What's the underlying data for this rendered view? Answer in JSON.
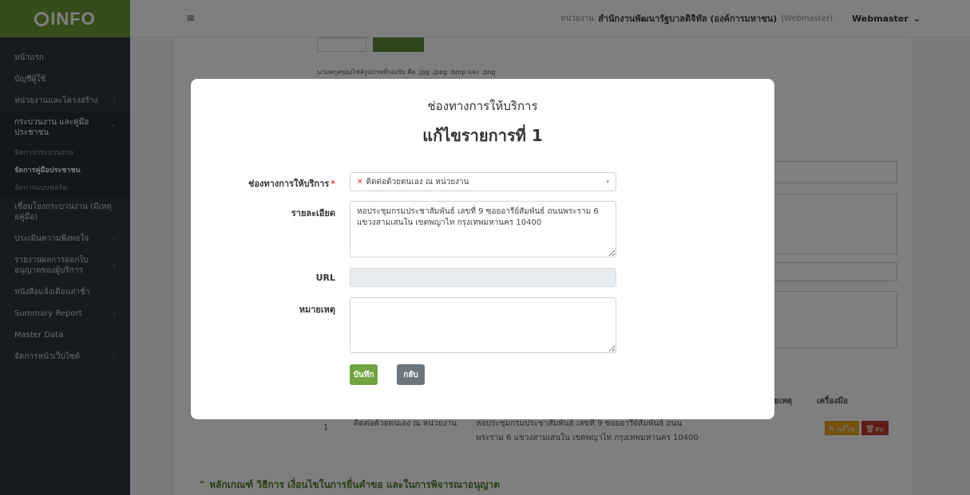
{
  "sidebar": {
    "brand": "INFO",
    "items": [
      {
        "label": "หน้าแรก",
        "chev": ""
      },
      {
        "label": "บัญชีผู้ใช้",
        "chev": "›"
      },
      {
        "label": "หน่วยงานและโครงสร้าง",
        "chev": "›"
      },
      {
        "label": "กระบวนงาน และคู่มือประชาชน",
        "chev": "⌃"
      },
      {
        "label": "เชื่อมโยงกระบวนงาน (มีเหตุอคู่มือ)",
        "chev": ""
      },
      {
        "label": "ประเมินความพึงพอใจ",
        "chev": "›"
      },
      {
        "label": "รายงานผลการออกใบ อนุญาตของผู้บริการ",
        "chev": "›"
      },
      {
        "label": "หนังสือแจ้งเตือนล่าช้า",
        "chev": ""
      },
      {
        "label": "Summary Report",
        "chev": "›"
      },
      {
        "label": "Master Data",
        "chev": "›"
      },
      {
        "label": "จัดการหน้าเว็บไซต์",
        "chev": "›"
      }
    ],
    "sub_items": [
      "จัดการกระบวนงาน",
      "จัดการคู่มือประชาชน",
      "จัดการแบบฟอร์ม"
    ]
  },
  "topbar": {
    "burger": "≡",
    "org_prefix": "หน่วยงาน",
    "org_name": "สำนักงานพัฒนารัฐบาลดิจิทัล (องค์การมหาชน)",
    "role": "(Webmaster)",
    "user": "Webmaster",
    "user_caret": "⌄"
  },
  "background": {
    "upload_hint": "นามสกุลของไฟล์รูปภาพที่รองรับ คือ .jpg .jpeg .bmp และ .png",
    "col_note": "หมายเหตุ",
    "col_tools": "เครื่องมือ",
    "row_no": "1",
    "row_channel": "ติดต่อด้วยตนเอง ณ หน่วยงาน",
    "row_detail_1": "หอประชุมกรมประชาสัมพันธ์ เลขที่ 9 ซอยอารีย์สัมพันธ์ ถนน",
    "row_detail_2": "พระราม 6 แขวงสามเสนใน เขตพญาไท กรุงเทพมหานคร 10400",
    "edit_label": "แก้ไข",
    "delete_label": "ลบ",
    "section_heading": "หลักเกณฑ์ วิธีการ เงื่อนไขในการยื่นคำขอ และในการพิจารณาอนุญาต"
  },
  "modal": {
    "title": "ช่องทางการให้บริการ",
    "subtitle": "แก้ไขรายการที่ 1",
    "channel_label": "ช่องทางการให้บริการ",
    "required_mark": "*",
    "channel_value": "ติดต่อด้วยตนเอง ณ หน่วยงาน",
    "channel_clear": "×",
    "channel_caret": "▾",
    "detail_label": "รายละเอียด",
    "detail_value": "หอประชุมกรมประชาสัมพันธ์ เลขที่ 9 ซอยอารีย์สัมพันธ์ ถนนพระราม 6 แขวงสามเสนใน เขตพญาไท กรุงเทพมหานคร 10400",
    "url_label": "URL",
    "url_value": "",
    "note_label": "หมายเหตุ",
    "note_value": "",
    "save_label": "บันทึก",
    "back_label": "กลับ"
  },
  "colors": {
    "brand_green": "#6a9a37",
    "sidebar_bg": "#2f3640",
    "save_button": "#71a340",
    "back_button": "#6c757d",
    "required": "#e0403a"
  }
}
